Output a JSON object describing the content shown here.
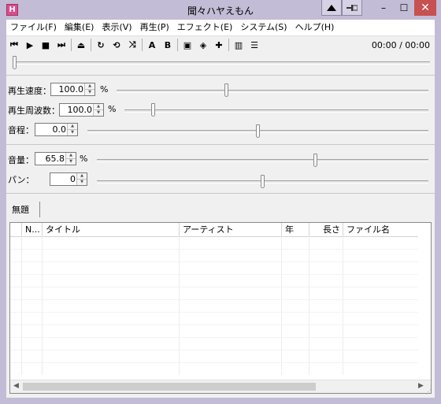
{
  "window": {
    "title": "聞々ハヤえもん",
    "app_icon_glyph": "H",
    "controls": {
      "minimize": "–",
      "maximize": "☐",
      "close": "✕"
    }
  },
  "menu": [
    {
      "label": "ファイル(F)"
    },
    {
      "label": "編集(E)"
    },
    {
      "label": "表示(V)"
    },
    {
      "label": "再生(P)"
    },
    {
      "label": "エフェクト(E)"
    },
    {
      "label": "システム(S)"
    },
    {
      "label": "ヘルプ(H)"
    }
  ],
  "toolbar": {
    "buttons": [
      {
        "icon": "previous-track-icon",
        "glyph": "⏮"
      },
      {
        "icon": "play-icon",
        "glyph": "▶"
      },
      {
        "icon": "stop-icon",
        "glyph": "■"
      },
      {
        "icon": "next-track-icon",
        "glyph": "⏭"
      },
      {
        "icon": "eject-icon",
        "glyph": "⏏"
      },
      {
        "icon": "repeat-one-icon",
        "glyph": "↻"
      },
      {
        "icon": "repeat-all-icon",
        "glyph": "⟲"
      },
      {
        "icon": "random-icon",
        "glyph": "⤨"
      },
      {
        "icon": "ab-loop-a-icon",
        "glyph": "A"
      },
      {
        "icon": "ab-loop-b-icon",
        "glyph": "B"
      },
      {
        "icon": "marker-play-icon",
        "glyph": "▣"
      },
      {
        "icon": "add-marker-icon",
        "glyph": "◈"
      },
      {
        "icon": "delete-marker-icon",
        "glyph": "✚"
      },
      {
        "icon": "explorer-icon",
        "glyph": "▥"
      },
      {
        "icon": "playlist-icon",
        "glyph": "☰"
      }
    ],
    "time": "00:00 / 00:00"
  },
  "seek": {
    "position": 0.0
  },
  "controls": {
    "speed": {
      "label": "再生速度：",
      "value": "100.0",
      "unit": "%",
      "level": 0.35
    },
    "frequency": {
      "label": "再生周波数：",
      "value": "100.0",
      "unit": "%",
      "level": 0.09
    },
    "pitch": {
      "label": "音程：",
      "value": "0.0",
      "unit": "",
      "level": 0.5
    },
    "volume": {
      "label": "音量：",
      "value": "65.8",
      "unit": "%",
      "level": 0.66
    },
    "pan": {
      "label": "パン：",
      "value": "0",
      "unit": "",
      "level": 0.5
    }
  },
  "tabs": [
    {
      "label": "無題"
    }
  ],
  "playlist": {
    "columns": [
      {
        "label": ""
      },
      {
        "label": "N..."
      },
      {
        "label": "タイトル"
      },
      {
        "label": "アーティスト"
      },
      {
        "label": "年"
      },
      {
        "label": "長さ"
      },
      {
        "label": "ファイル名"
      }
    ],
    "rows": []
  },
  "colors": {
    "title_bar": "#c3bcd6",
    "close_button": "#c75050",
    "background": "#f0f0f0"
  }
}
